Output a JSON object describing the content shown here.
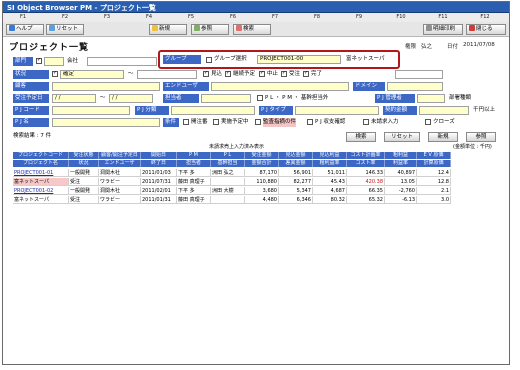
{
  "window": {
    "title": "SI Object Browser PM - プロジェクト一覧"
  },
  "fkeys": [
    "F1",
    "F2",
    "F3",
    "F4",
    "F5",
    "F6",
    "F7",
    "F8",
    "F9",
    "F10",
    "F11",
    "F12"
  ],
  "toolbar": {
    "help": "ヘルプ",
    "reset": "リセット",
    "new": "新規",
    "view": "参照",
    "search": "検索",
    "detail": "明細印刷",
    "close": "閉じる",
    "icons": {
      "help": "help-icon",
      "reset": "reset-icon",
      "new": "new-icon",
      "view": "view-icon",
      "search": "search-icon",
      "detail": "print-icon",
      "close": "close-icon"
    }
  },
  "header": {
    "page_title": "プロジェクト一覧",
    "user_label": "権限",
    "user_name": "弘之",
    "date_label": "日付",
    "date_value": "2011/07/08"
  },
  "form": {
    "dept_label": "部門",
    "dept_value": "会社",
    "group_label": "グループ",
    "group_check": "グループ選択",
    "group_code": "PROJECT001-00",
    "group_name": "富ネットスーパ",
    "status_label": "状況",
    "status_value": "確定",
    "status_opts": [
      "見込",
      "継続予定",
      "中止",
      "受注",
      "完了"
    ],
    "client_label": "顧客",
    "user_field_label": "エンドユーザ",
    "domain_label": "ドメイン",
    "plan_date_label": "受注予定日",
    "date_from": "/ /",
    "date_tilde": "～",
    "date_to": "/ /",
    "owner_label": "担当者",
    "pl_pm_text": "P L ・ P M ・ 基幹担当外",
    "pj_mgr_label": "P J 管理者",
    "dept_org_label": "部署種類",
    "pjcode_label": "P J コード",
    "pjcat_label": "P J 分類",
    "pjtype_label": "P J タイプ",
    "amount_label": "契約金額",
    "unit": "千円以上",
    "pjname_label": "P J 名",
    "cond_label": "条件",
    "cond_opts": [
      "開注番",
      "実施予定中",
      "監査指摘の件",
      "P J 収支確認",
      "未請求入力 ",
      "クローズ"
    ],
    "result_label": "検索結果 : 7 件",
    "btn_search": "検索",
    "btn_reset": "リセット",
    "btn_new": "新規",
    "btn_view": "参照"
  },
  "grid_note": "未請求売上入力済み表示",
  "grid_unit": "(金額単位 : 千円)",
  "columns": [
    [
      "プロジェクトコード",
      "プロジェクト名"
    ],
    [
      "受注状態",
      "状況"
    ],
    [
      "顧客/開注予定日",
      "エンドユーザ"
    ],
    [
      "開始日",
      "終了日"
    ],
    [
      "P M",
      "担当者"
    ],
    [
      "P L",
      "基幹担当"
    ],
    [
      "受注金額",
      "金額合計"
    ],
    [
      "見込金額",
      "差異金額"
    ],
    [
      "見込利益",
      "粗利益率"
    ],
    [
      "コスト計画率",
      "コスト率"
    ],
    [
      "粗利益",
      "利益率"
    ],
    [
      "E V 原価",
      "計算原価"
    ]
  ],
  "rows": [
    {
      "c1": "PROJECT001-01",
      "c1b": "富ネットスーパ",
      "s1": "一般開発",
      "s2": "受注",
      "cl": "洞関木社",
      "cl2": "ワラビー",
      "d1": "2011/01/03",
      "d2": "2011/07/31",
      "pm": "下平 多",
      "pm2": "藤田 真理子",
      "pl": "洲田 弘之",
      "pl2": "",
      "a1": "87,170",
      "a2": "110,880",
      "b1": "56,901",
      "b2": "82,277",
      "e1": "51,011",
      "e2": "45.43",
      "f1": "146.33",
      "f2": "420.38",
      "g1": "40,897",
      "g2": "13.05",
      "h1": "12.4",
      "h2": "12.8",
      "hl": true
    },
    {
      "c1": "PROJECT001-02",
      "c1b": "富ネットスーパ",
      "s1": "一般開発",
      "s2": "受注",
      "cl": "洞関木社",
      "cl2": "ワラビー",
      "d1": "2011/02/01",
      "d2": "2011/01/31",
      "pm": "下平 多",
      "pm2": "藤田 真理子",
      "pl": "洲田 大樹",
      "pl2": "",
      "a1": "3,680",
      "a2": "4,480",
      "b1": "5,347",
      "b2": "6,346",
      "e1": "4,687",
      "e2": "80.32",
      "f1": "66.35",
      "f2": "65.32",
      "g1": "-2,760",
      "g2": "-6.13",
      "h1": "2.1",
      "h2": "3.0",
      "hl": false
    }
  ]
}
